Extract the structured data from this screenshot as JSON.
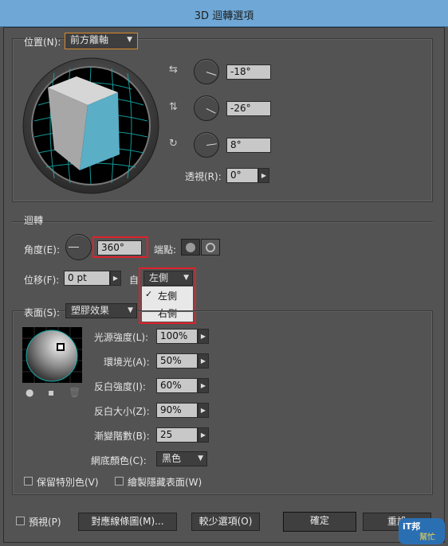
{
  "window": {
    "title": "3D 迴轉選項"
  },
  "position": {
    "label": "位置(N):",
    "preset": "前方離軸",
    "x_angle": "-18°",
    "y_angle": "-26°",
    "z_angle": "8°",
    "perspective_label": "透視(R):",
    "perspective": "0°"
  },
  "revolve": {
    "section": "迴轉",
    "angle_label": "角度(E):",
    "angle": "360°",
    "cap_label": "端點:",
    "offset_label": "位移(F):",
    "offset": "0 pt",
    "from_label": "自",
    "from_value": "左側",
    "from_options": [
      "左側",
      "右側"
    ],
    "from_selected_mark": "✓"
  },
  "surface": {
    "label": "表面(S):",
    "value": "塑膠效果",
    "light_intensity_label": "光源強度(L):",
    "light_intensity": "100%",
    "ambient_label": "環境光(A):",
    "ambient": "50%",
    "highlight_intensity_label": "反白強度(I):",
    "highlight_intensity": "60%",
    "highlight_size_label": "反白大小(Z):",
    "highlight_size": "90%",
    "blend_steps_label": "漸變階數(B):",
    "blend_steps": "25",
    "shade_color_label": "網底顏色(C):",
    "shade_color": "黑色",
    "preserve_spot_label": "保留特別色(V)",
    "draw_hidden_label": "繪製隱藏表面(W)"
  },
  "footer": {
    "preview_label": "預視(P)",
    "map_art_label": "對應線條圖(M)...",
    "fewer_options_label": "較少選項(O)",
    "ok_label": "確定",
    "reset_label": "重設"
  },
  "watermark": {
    "brand_top": "iT邦",
    "brand_bottom": "幫忙"
  },
  "colors": {
    "cube_face": "#5aaec6",
    "cube_side": "#a9a9a9",
    "cube_top": "#d4d4d4",
    "grid": "#18a8a8",
    "highlight_border": "#e0202a"
  }
}
